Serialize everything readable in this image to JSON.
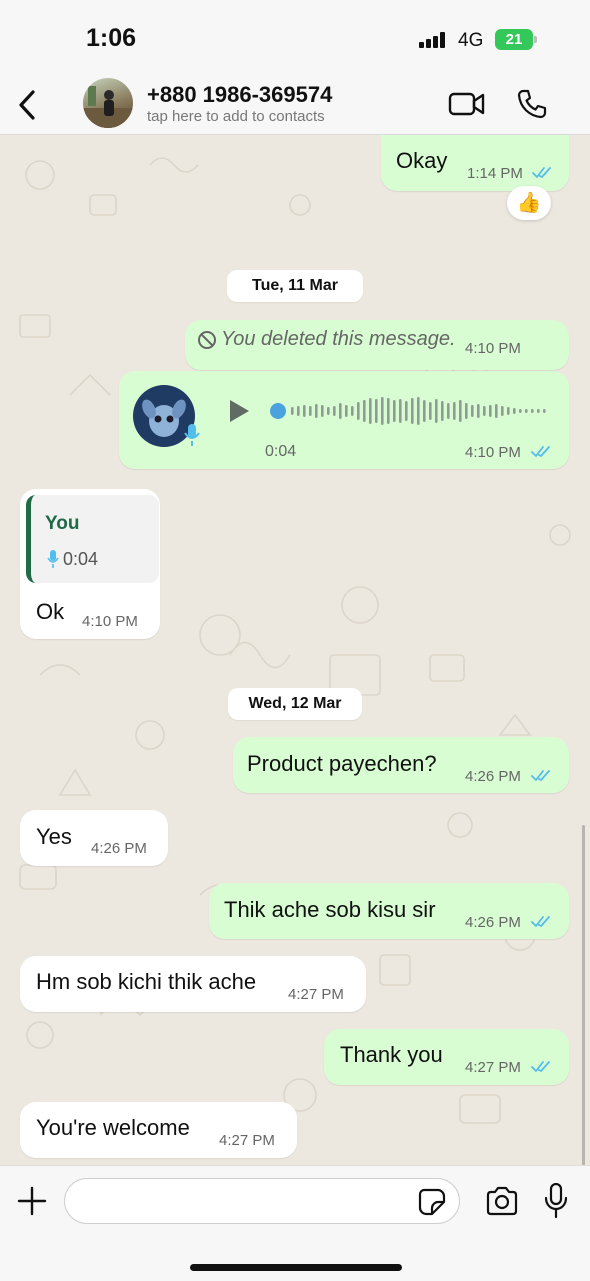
{
  "status_bar": {
    "time": "1:06",
    "network": "4G",
    "battery": "21"
  },
  "header": {
    "contact_name": "+880 1986-369574",
    "contact_subtitle": "tap here to add to contacts"
  },
  "messages": {
    "m1": {
      "text": "Okay",
      "time": "1:14 PM",
      "reaction": "👍"
    },
    "date1": "Tue, 11 Mar",
    "m2": {
      "text": "You deleted this message.",
      "time": "4:10 PM"
    },
    "m3": {
      "duration": "0:04",
      "time": "4:10 PM"
    },
    "m4": {
      "quote_author": "You",
      "quote_duration": "0:04",
      "text": "Ok",
      "time": "4:10 PM"
    },
    "date2": "Wed, 12 Mar",
    "m5": {
      "text": "Product payechen?",
      "time": "4:26 PM"
    },
    "m6": {
      "text": "Yes",
      "time": "4:26 PM"
    },
    "m7": {
      "text": "Thik ache sob kisu sir",
      "time": "4:26 PM"
    },
    "m8": {
      "text": "Hm sob kichi thik ache",
      "time": "4:27 PM"
    },
    "m9": {
      "text": "Thank you",
      "time": "4:27 PM"
    },
    "m10": {
      "text": "You're welcome",
      "time": "4:27 PM"
    }
  },
  "composer": {
    "placeholder": ""
  },
  "colors": {
    "outgoing": "#d9fdd3",
    "incoming": "#ffffff",
    "read_ticks": "#53bdeb",
    "accent": "#206a45"
  }
}
